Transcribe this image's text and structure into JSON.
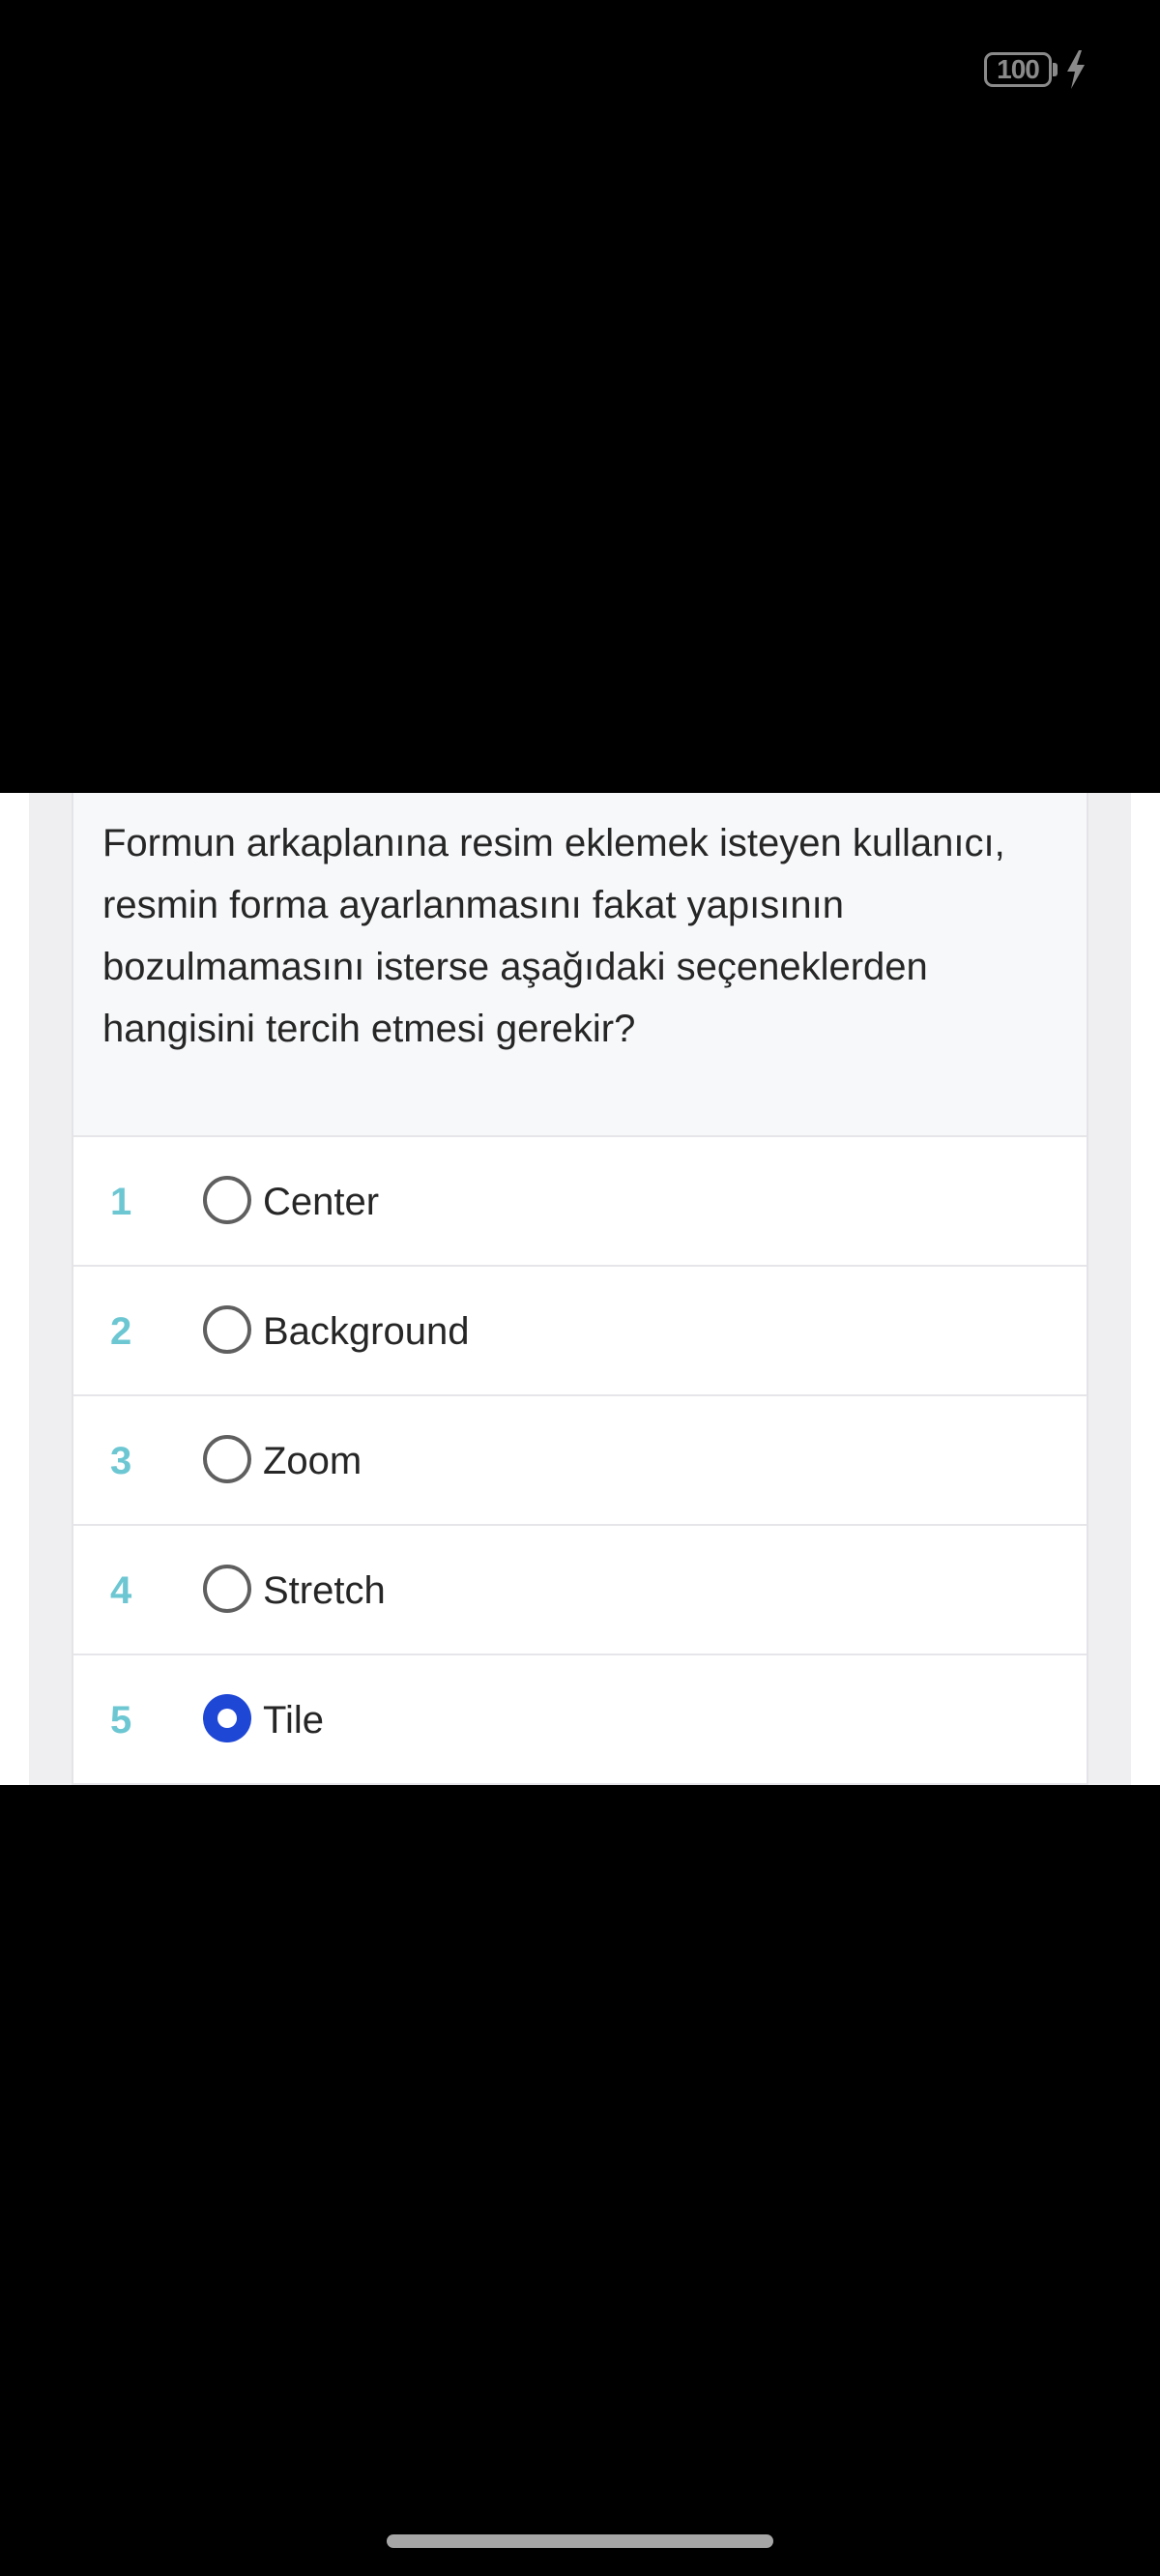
{
  "status_bar": {
    "battery_level": "100",
    "charging_icon": "lightning-bolt-icon"
  },
  "question": {
    "text": "Formun arkaplanına resim eklemek isteyen kullanıcı, resmin forma ayarlanmasını fakat yapısının bozulmamasını isterse aşağıdaki seçeneklerden hangisini tercih etmesi gerekir?"
  },
  "options": [
    {
      "number": "1",
      "label": "Center",
      "selected": false
    },
    {
      "number": "2",
      "label": "Background",
      "selected": false
    },
    {
      "number": "3",
      "label": "Zoom",
      "selected": false
    },
    {
      "number": "4",
      "label": "Stretch",
      "selected": false
    },
    {
      "number": "5",
      "label": "Tile",
      "selected": true
    }
  ],
  "colors": {
    "option_number": "#6cc7d3",
    "radio_selected": "#1f47d6",
    "question_background": "#f7f8fa"
  }
}
